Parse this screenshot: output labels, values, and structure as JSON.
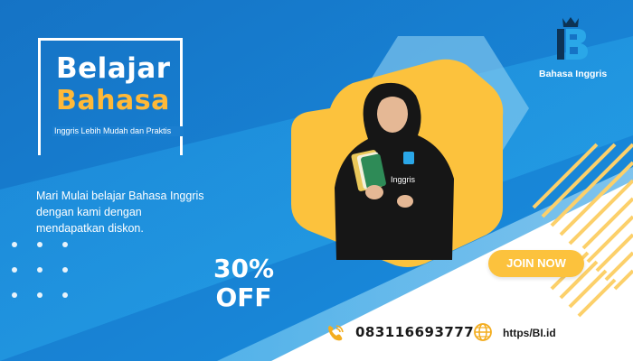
{
  "headline": {
    "line1": "Belajar",
    "line2": "Bahasa",
    "subtitle": "Inggris Lebih Mudah dan Praktis"
  },
  "description": "Mari Mulai belajar Bahasa Inggris dengan kami dengan mendapatkan diskon.",
  "discount": {
    "percent": "30%",
    "off": "OFF"
  },
  "cta": {
    "label": "JOIN NOW"
  },
  "brand": {
    "name": "Bahasa Inggris"
  },
  "model": {
    "shirt_label": "Inggris"
  },
  "contact": {
    "phone": "083116693777",
    "url": "https/BI.id"
  },
  "icons": {
    "phone": "phone-icon",
    "globe": "globe-icon",
    "logo": "crown-bi-logo-icon"
  },
  "colors": {
    "blue_dark": "#1669b8",
    "blue_light": "#2aa7e8",
    "accent_yellow": "#fcc23d",
    "text_dark": "#1a1a1a"
  }
}
